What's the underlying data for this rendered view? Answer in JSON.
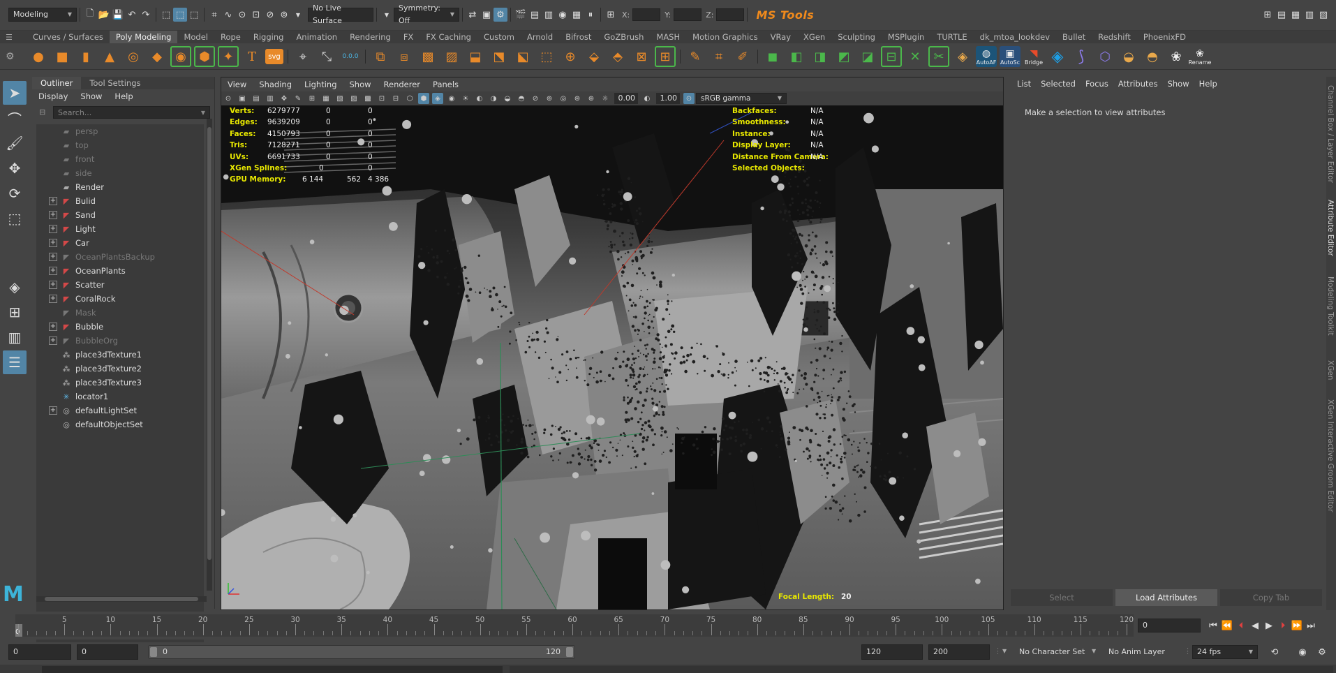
{
  "status_line": {
    "mode": "Modeling",
    "live_surface": "No Live Surface",
    "symmetry": "Symmetry: Off",
    "x_label": "X:",
    "y_label": "Y:",
    "z_label": "Z:",
    "logo": "MS Tools"
  },
  "shelf_tabs": [
    "Curves / Surfaces",
    "Poly Modeling",
    "Model",
    "Rope",
    "Rigging",
    "Animation",
    "Rendering",
    "FX",
    "FX Caching",
    "Custom",
    "Arnold",
    "Bifrost",
    "GoZBrush",
    "MASH",
    "Motion Graphics",
    "VRay",
    "XGen",
    "Sculpting",
    "MSPlugin",
    "TURTLE",
    "dk_mtoa_lookdev",
    "Bullet",
    "Redshift",
    "PhoenixFD"
  ],
  "shelf_active": "Poly Modeling",
  "shelf_labels": {
    "autoaf": "AutoAF",
    "autosc": "AutoSc",
    "bridge": "Bridge",
    "rename": "Rename",
    "svg": "svg",
    "text": "T",
    "counter": "0.0.0"
  },
  "outliner": {
    "tabs": [
      "Outliner",
      "Tool Settings"
    ],
    "menu": [
      "Display",
      "Show",
      "Help"
    ],
    "search_placeholder": "Search...",
    "items": [
      {
        "label": "persp",
        "type": "camera",
        "dim": true,
        "expand": false
      },
      {
        "label": "top",
        "type": "camera",
        "dim": true,
        "expand": false
      },
      {
        "label": "front",
        "type": "camera",
        "dim": true,
        "expand": false
      },
      {
        "label": "side",
        "type": "camera",
        "dim": true,
        "expand": false
      },
      {
        "label": "Render",
        "type": "camera",
        "dim": false,
        "expand": false
      },
      {
        "label": "Bulid",
        "type": "group",
        "dim": false,
        "expand": true
      },
      {
        "label": "Sand",
        "type": "group",
        "dim": false,
        "expand": true
      },
      {
        "label": "Light",
        "type": "group",
        "dim": false,
        "expand": true
      },
      {
        "label": "Car",
        "type": "group",
        "dim": false,
        "expand": true
      },
      {
        "label": "OceanPlantsBackup",
        "type": "group",
        "dim": true,
        "expand": true
      },
      {
        "label": "OceanPlants",
        "type": "group",
        "dim": false,
        "expand": true
      },
      {
        "label": "Scatter",
        "type": "group",
        "dim": false,
        "expand": true
      },
      {
        "label": "CoralRock",
        "type": "group",
        "dim": false,
        "expand": true
      },
      {
        "label": "Mask",
        "type": "group",
        "dim": true,
        "expand": false
      },
      {
        "label": "Bubble",
        "type": "group",
        "dim": false,
        "expand": true
      },
      {
        "label": "BubbleOrg",
        "type": "group",
        "dim": true,
        "expand": true
      },
      {
        "label": "place3dTexture1",
        "type": "texture",
        "dim": false,
        "expand": false
      },
      {
        "label": "place3dTexture2",
        "type": "texture",
        "dim": false,
        "expand": false
      },
      {
        "label": "place3dTexture3",
        "type": "texture",
        "dim": false,
        "expand": false
      },
      {
        "label": "locator1",
        "type": "locator",
        "dim": false,
        "expand": false
      },
      {
        "label": "defaultLightSet",
        "type": "set",
        "dim": false,
        "expand": true
      },
      {
        "label": "defaultObjectSet",
        "type": "set",
        "dim": false,
        "expand": false
      }
    ]
  },
  "viewport": {
    "menu": [
      "View",
      "Shading",
      "Lighting",
      "Show",
      "Renderer",
      "Panels"
    ],
    "near": "0.00",
    "far": "1.00",
    "color_space": "sRGB gamma",
    "hud_left": [
      {
        "label": "Verts:",
        "v1": "6279777",
        "v2": "0",
        "v3": "0"
      },
      {
        "label": "Edges:",
        "v1": "9639209",
        "v2": "0",
        "v3": "0"
      },
      {
        "label": "Faces:",
        "v1": "4150793",
        "v2": "0",
        "v3": "0"
      },
      {
        "label": "Tris:",
        "v1": "7128271",
        "v2": "0",
        "v3": "0"
      },
      {
        "label": "UVs:",
        "v1": "6691733",
        "v2": "0",
        "v3": "0"
      },
      {
        "label": "XGen Splines:",
        "v1": "",
        "v2": "0",
        "v3": "0"
      },
      {
        "label": "GPU Memory:",
        "v1": "6 144",
        "v2": "562",
        "v3": "4 386"
      }
    ],
    "hud_right": [
      {
        "label": "Backfaces:",
        "value": "N/A"
      },
      {
        "label": "Smoothness:",
        "value": "N/A"
      },
      {
        "label": "Instance:",
        "value": "N/A"
      },
      {
        "label": "Display Layer:",
        "value": "N/A"
      },
      {
        "label": "Distance From Camera:",
        "value": "N/A"
      },
      {
        "label": "Selected Objects:",
        "value": ""
      }
    ],
    "focal_label": "Focal Length:",
    "focal_value": "20"
  },
  "attribute_editor": {
    "menu": [
      "List",
      "Selected",
      "Focus",
      "Attributes",
      "Show",
      "Help"
    ],
    "message": "Make a selection to view attributes",
    "buttons": [
      "Select",
      "Load Attributes",
      "Copy Tab"
    ],
    "side_tabs": [
      "Channel Box / Layer Editor",
      "Attribute Editor",
      "Modeling Toolkit",
      "XGen",
      "XGen Interactive Groom Editor"
    ]
  },
  "time_slider": {
    "ticks": [
      "0",
      "5",
      "10",
      "15",
      "20",
      "25",
      "30",
      "35",
      "40",
      "45",
      "50",
      "55",
      "60",
      "65",
      "70",
      "75",
      "80",
      "85",
      "90",
      "95",
      "100",
      "105",
      "110",
      "115",
      "120"
    ],
    "current_frame": "0",
    "current_frame_field": "0"
  },
  "range_slider": {
    "start": "0",
    "playback_start": "0",
    "range_start": "0",
    "range_end": "120",
    "playback_end": "120",
    "end": "200",
    "character_set": "No Character Set",
    "anim_layer": "No Anim Layer",
    "fps": "24 fps"
  }
}
